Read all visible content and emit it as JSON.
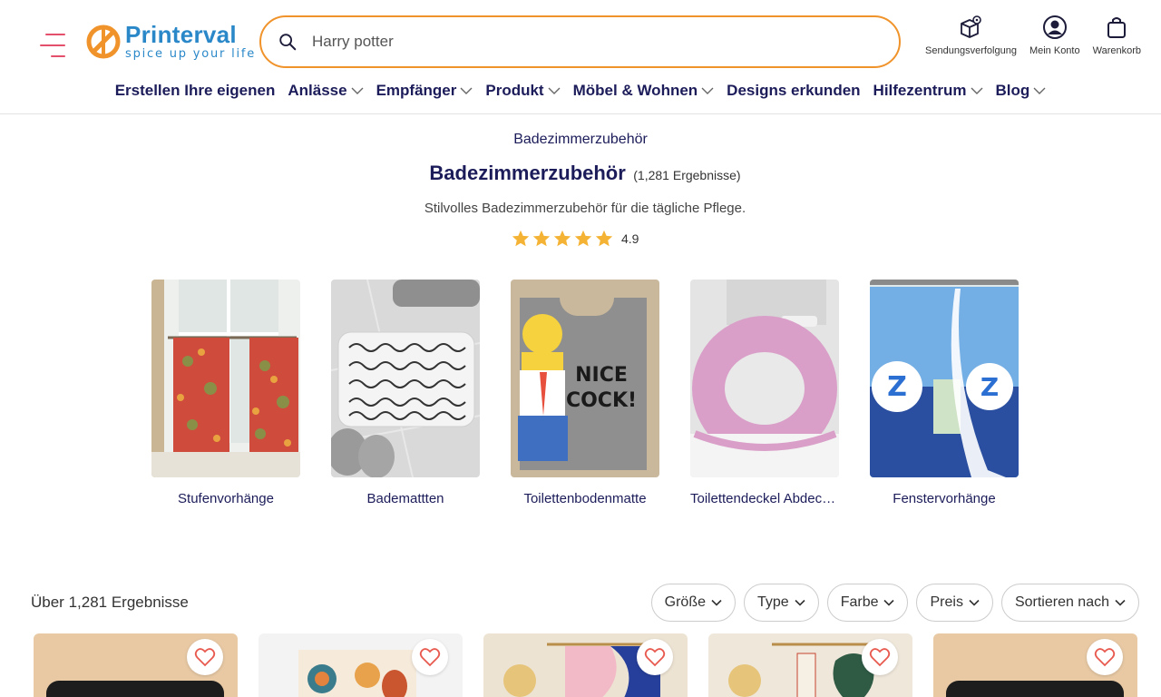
{
  "brand": {
    "name": "Printerval",
    "tagline": "spice up your life",
    "primary_color": "#2a88c9",
    "accent_color": "#f0932b"
  },
  "search": {
    "placeholder": "Harry potter"
  },
  "header_actions": [
    {
      "label": "Sendungsverfolgung",
      "icon": "package-tracking-icon"
    },
    {
      "label": "Mein Konto",
      "icon": "account-icon"
    },
    {
      "label": "Warenkorb",
      "icon": "cart-icon"
    }
  ],
  "nav": [
    {
      "label": "Erstellen Ihre eigenen",
      "dropdown": false
    },
    {
      "label": "Anlässe",
      "dropdown": true
    },
    {
      "label": "Empfänger",
      "dropdown": true
    },
    {
      "label": "Produkt",
      "dropdown": true
    },
    {
      "label": "Möbel & Wohnen",
      "dropdown": true
    },
    {
      "label": "Designs erkunden",
      "dropdown": false
    },
    {
      "label": "Hilfezentrum",
      "dropdown": true
    },
    {
      "label": "Blog",
      "dropdown": true
    }
  ],
  "breadcrumb": "Badezimmerzubehör",
  "page": {
    "title": "Badezimmerzubehör",
    "count": "(1,281 Ergebnisse)",
    "description": "Stilvolles Badezimmerzubehör für die tägliche Pflege.",
    "rating": "4.9",
    "stars": 5
  },
  "categories": [
    {
      "label": "Stufenvorhänge"
    },
    {
      "label": "Bademattten"
    },
    {
      "label": "Toilettenbodenmatte"
    },
    {
      "label": "Toilettendeckel Abdeckung"
    },
    {
      "label": "Fenstervorhänge"
    }
  ],
  "results": {
    "count_text": "Über 1,281 Ergebnisse",
    "filters": [
      "Größe",
      "Type",
      "Farbe",
      "Preis",
      "Sortieren nach"
    ]
  },
  "products": [
    {
      "name": "product-1"
    },
    {
      "name": "product-2"
    },
    {
      "name": "product-3"
    },
    {
      "name": "product-4"
    },
    {
      "name": "product-5"
    }
  ]
}
